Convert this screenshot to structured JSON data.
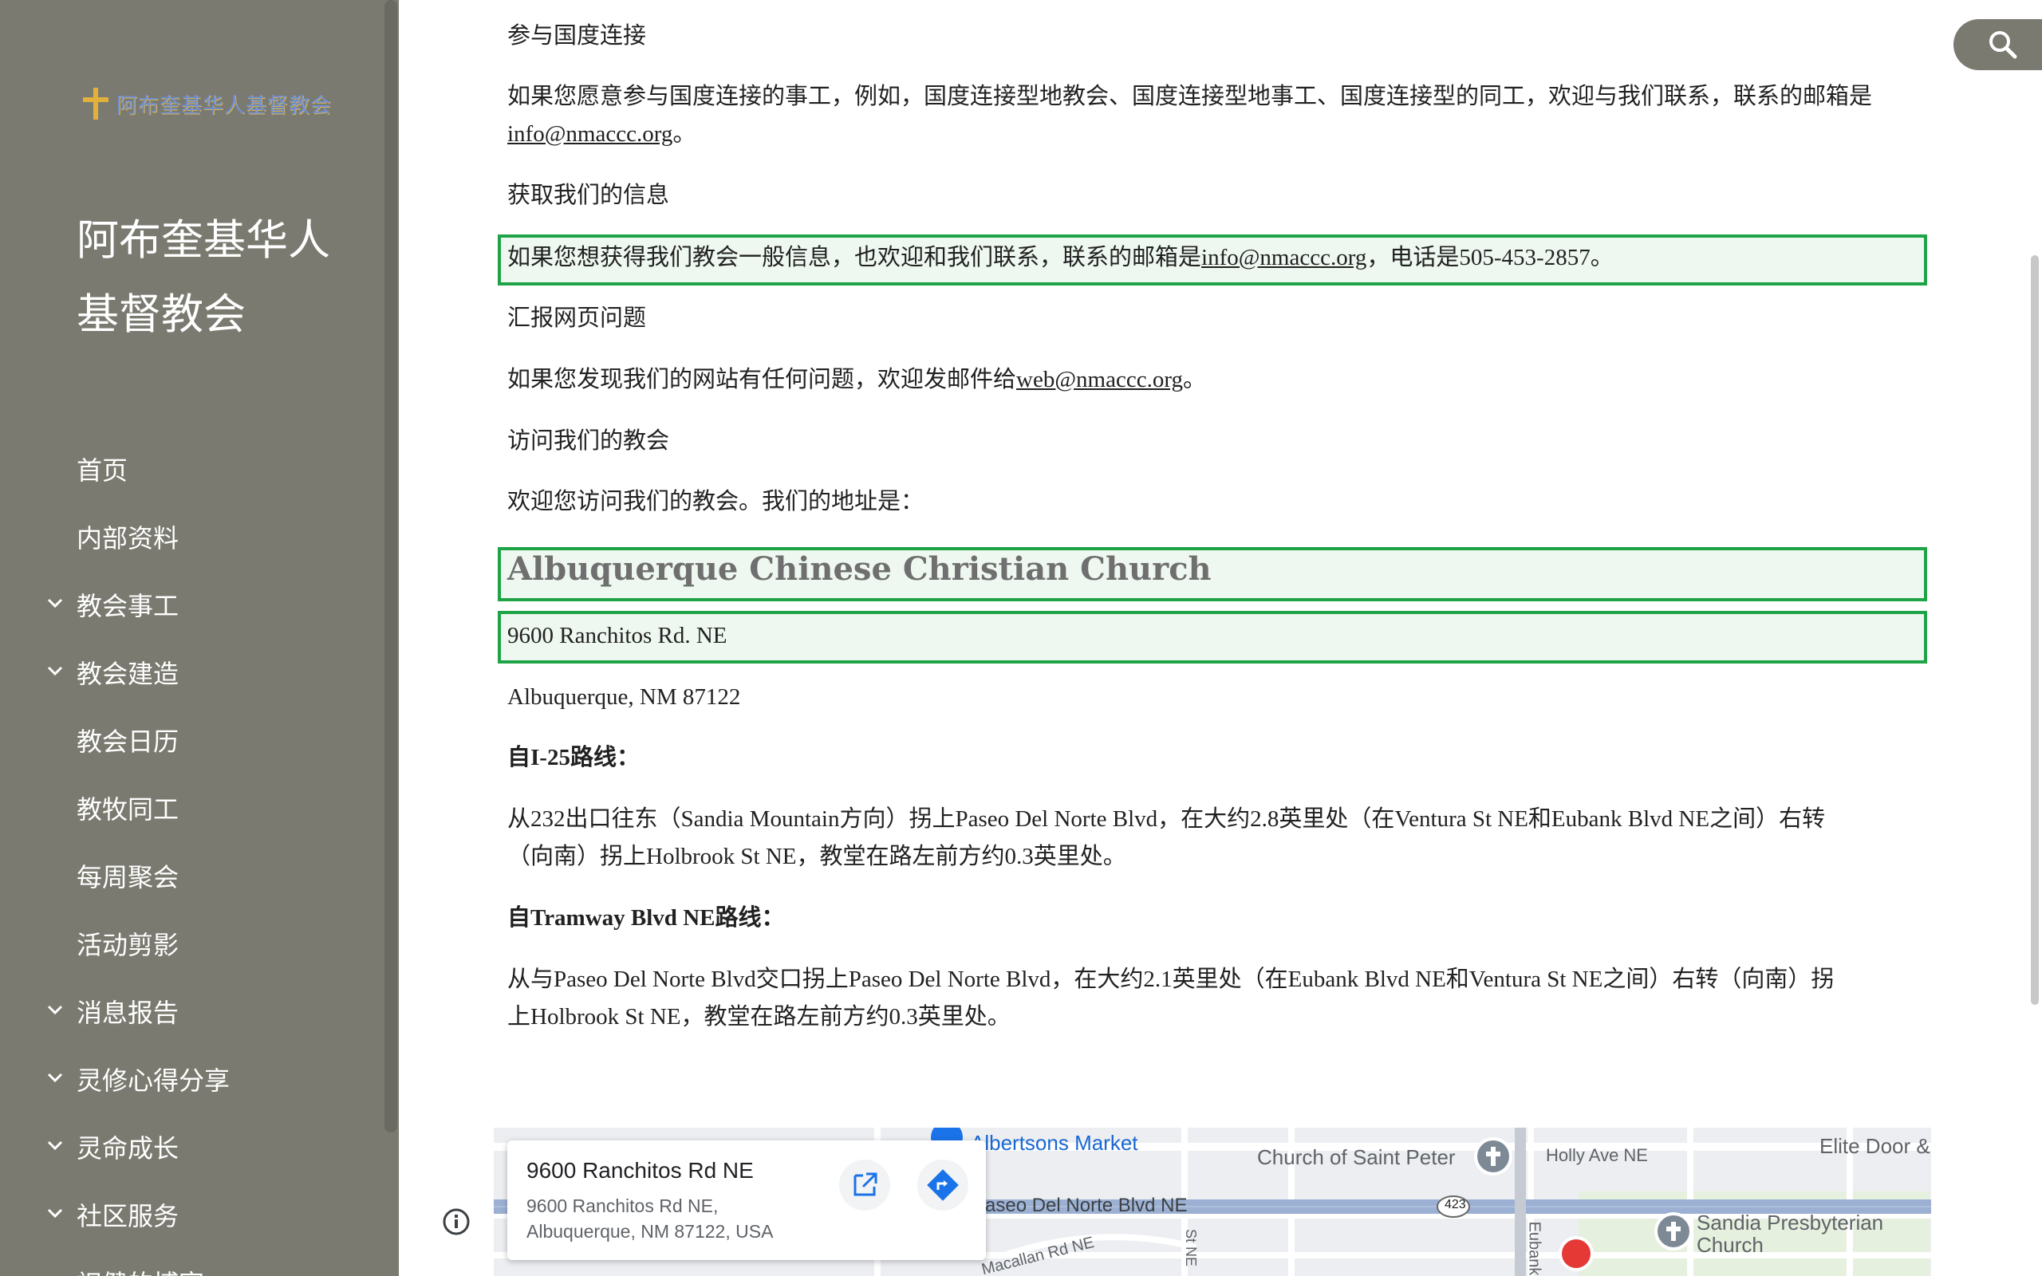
{
  "sidebar": {
    "logo_text": "阿布奎基华人基督教会",
    "site_title_line1": "阿布奎基华人",
    "site_title_line2": "基督教会",
    "nav": [
      {
        "label": "首页",
        "expandable": false
      },
      {
        "label": "内部资料",
        "expandable": false
      },
      {
        "label": "教会事工",
        "expandable": true
      },
      {
        "label": "教会建造",
        "expandable": true
      },
      {
        "label": "教会日历",
        "expandable": false
      },
      {
        "label": "教牧同工",
        "expandable": false
      },
      {
        "label": "每周聚会",
        "expandable": false
      },
      {
        "label": "活动剪影",
        "expandable": false
      },
      {
        "label": "消息报告",
        "expandable": true
      },
      {
        "label": "灵修心得分享",
        "expandable": true
      },
      {
        "label": "灵命成长",
        "expandable": true
      },
      {
        "label": "社区服务",
        "expandable": true
      },
      {
        "label": "祝健的博客",
        "expandable": true
      }
    ]
  },
  "content": {
    "p1": "参与国度连接",
    "p2_text": "如果您愿意参与国度连接的事工，例如，国度连接型地教会、国度连接型地事工、国度连接型的同工，欢迎与我们联系，联系的邮箱是",
    "p2_email": "info@nmaccc.org",
    "p2_end": "。",
    "p3": "获取我们的信息",
    "p4_text": "如果您想获得我们教会一般信息，也欢迎和我们联系，联系的邮箱是",
    "p4_email": "info@nmaccc.org",
    "p4_end": "，电话是505-453-2857。",
    "p5": "汇报网页问题",
    "p6_text": "如果您发现我们的网站有任何问题，欢迎发邮件给",
    "p6_email": "web@nmaccc.org",
    "p6_end": "。",
    "p7": "访问我们的教会",
    "p8": "欢迎您访问我们的教会。我们的地址是：",
    "church_name": "Albuquerque Chinese Christian Church",
    "address_line1": "9600 Ranchitos Rd. NE",
    "address_line2": "Albuquerque, NM 87122",
    "route1_title": "自I-25路线：",
    "route1_line1": "从232出口往东（Sandia Mountain方向）拐上Paseo Del Norte Blvd，在大约2.8英里处（在Ventura St NE和Eubank Blvd NE之间）右转",
    "route1_line2": "（向南）拐上Holbrook St NE，教堂在路左前方约0.3英里处。",
    "route2_title": "自Tramway Blvd NE路线：",
    "route2_line1": "从与Paseo Del Norte Blvd交口拐上Paseo Del Norte Blvd，在大约2.1英里处（在Eubank Blvd NE和Ventura St NE之间）右转（向南）拐",
    "route2_line2": "上Holbrook St NE，教堂在路左前方约0.3英里处。"
  },
  "map": {
    "card_title": "9600 Ranchitos Rd NE",
    "card_addr1": "9600 Ranchitos Rd NE,",
    "card_addr2": "Albuquerque, NM 87122, USA",
    "labels": {
      "albertsons": "Albertsons Market",
      "saint_peter": "Church of Saint Peter",
      "holly": "Holly Ave NE",
      "elite": "Elite Door &",
      "paseo": "Paseo Del Norte Blvd NE",
      "route_423": "423",
      "sandia1": "Sandia Presbyterian",
      "sandia2": "Church",
      "macallan": "Macallan Rd NE",
      "eubank": "Eubank",
      "st_ne": "St NE"
    },
    "colors": {
      "road_major": "#9bb0d3",
      "road_minor": "#ffffff",
      "park": "#e6f0de"
    }
  },
  "colors": {
    "sidebar_bg": "#7a7a70",
    "highlight_border": "#1ea446",
    "highlight_fill": "#eef8f0",
    "link": "#212121"
  }
}
